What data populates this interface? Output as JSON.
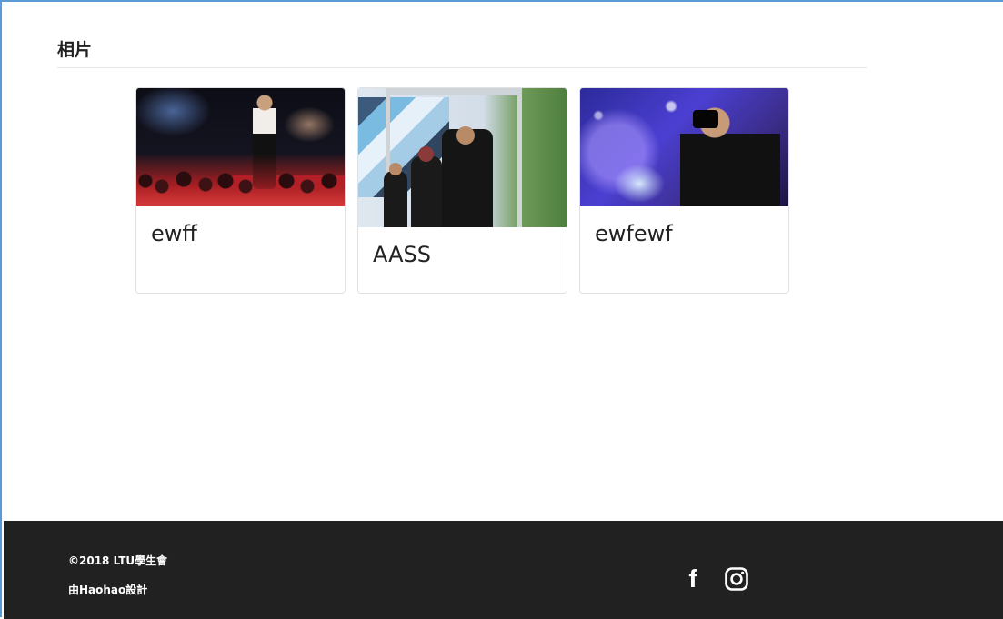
{
  "section": {
    "title": "相片"
  },
  "albums": [
    {
      "title": "ewff",
      "photo": "concert-stage-photo"
    },
    {
      "title": "AASS",
      "photo": "outdoor-stage-photo"
    },
    {
      "title": "ewfewf",
      "photo": "photographer-photo"
    }
  ],
  "footer": {
    "copyright": "©2018 LTU學生會",
    "designer": "由Haohao設計",
    "facebook_glyph": "f",
    "social_icons": [
      "facebook-icon",
      "instagram-icon"
    ]
  },
  "colors": {
    "page_background": "#ffffff",
    "footer_background": "#212121",
    "frame_border": "#5b9bd5",
    "text": "#222222"
  }
}
